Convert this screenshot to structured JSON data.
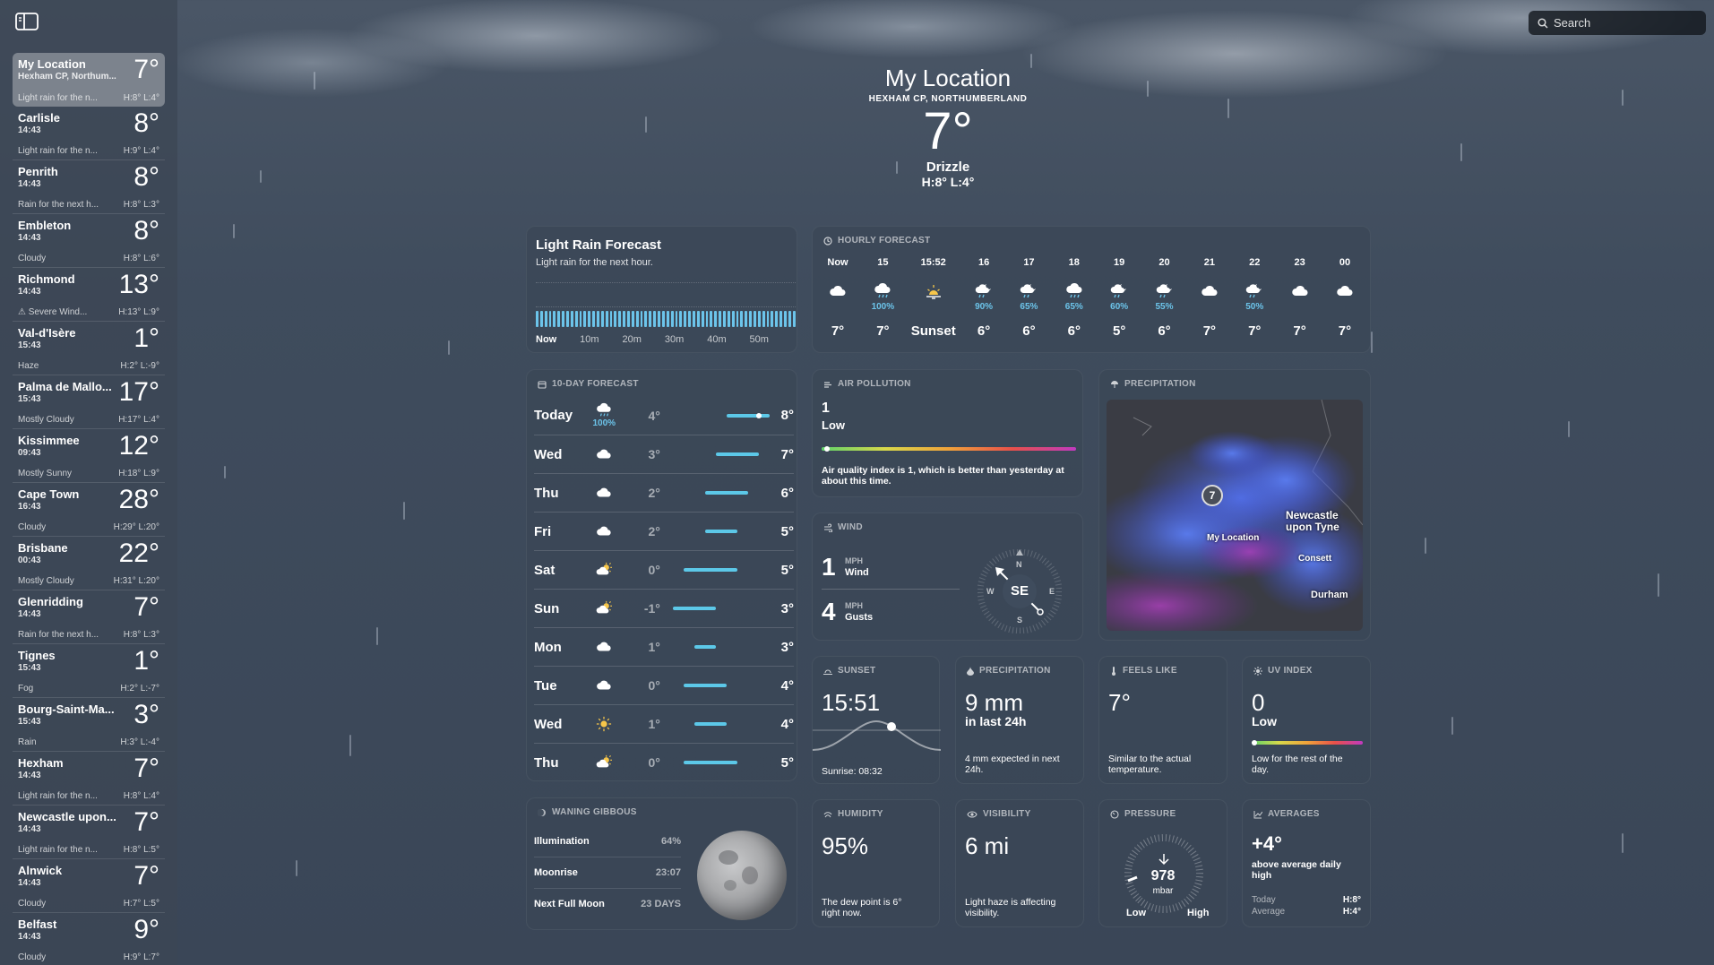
{
  "sidebar": {
    "locations": [
      {
        "name": "My Location",
        "time": "Hexham CP, Northum...",
        "temp": "7°",
        "cond": "Light rain for the n...",
        "hl": "H:8° L:4°",
        "selected": true
      },
      {
        "name": "Carlisle",
        "time": "14:43",
        "temp": "8°",
        "cond": "Light rain for the n...",
        "hl": "H:9° L:4°"
      },
      {
        "name": "Penrith",
        "time": "14:43",
        "temp": "8°",
        "cond": "Rain for the next h...",
        "hl": "H:8° L:3°"
      },
      {
        "name": "Embleton",
        "time": "14:43",
        "temp": "8°",
        "cond": "Cloudy",
        "hl": "H:8° L:6°"
      },
      {
        "name": "Richmond",
        "time": "14:43",
        "temp": "13°",
        "cond": "⚠ Severe Wind...",
        "hl": "H:13° L:9°"
      },
      {
        "name": "Val-d'Isère",
        "time": "15:43",
        "temp": "1°",
        "cond": "Haze",
        "hl": "H:2° L:-9°"
      },
      {
        "name": "Palma de Mallo...",
        "time": "15:43",
        "temp": "17°",
        "cond": "Mostly Cloudy",
        "hl": "H:17° L:4°"
      },
      {
        "name": "Kissimmee",
        "time": "09:43",
        "temp": "12°",
        "cond": "Mostly Sunny",
        "hl": "H:18° L:9°"
      },
      {
        "name": "Cape Town",
        "time": "16:43",
        "temp": "28°",
        "cond": "Cloudy",
        "hl": "H:29° L:20°"
      },
      {
        "name": "Brisbane",
        "time": "00:43",
        "temp": "22°",
        "cond": "Mostly Cloudy",
        "hl": "H:31° L:20°"
      },
      {
        "name": "Glenridding",
        "time": "14:43",
        "temp": "7°",
        "cond": "Rain for the next h...",
        "hl": "H:8° L:3°"
      },
      {
        "name": "Tignes",
        "time": "15:43",
        "temp": "1°",
        "cond": "Fog",
        "hl": "H:2° L:-7°"
      },
      {
        "name": "Bourg-Saint-Ma...",
        "time": "15:43",
        "temp": "3°",
        "cond": "Rain",
        "hl": "H:3° L:-4°"
      },
      {
        "name": "Hexham",
        "time": "14:43",
        "temp": "7°",
        "cond": "Light rain for the n...",
        "hl": "H:8° L:4°"
      },
      {
        "name": "Newcastle upon...",
        "time": "14:43",
        "temp": "7°",
        "cond": "Light rain for the n...",
        "hl": "H:8° L:5°"
      },
      {
        "name": "Alnwick",
        "time": "14:43",
        "temp": "7°",
        "cond": "Cloudy",
        "hl": "H:7° L:5°"
      },
      {
        "name": "Belfast",
        "time": "14:43",
        "temp": "9°",
        "cond": "Cloudy",
        "hl": "H:9° L:7°"
      }
    ]
  },
  "search": {
    "placeholder": "Search"
  },
  "header": {
    "title": "My Location",
    "subtitle": "HEXHAM CP, NORTHUMBERLAND",
    "temp": "7°",
    "condition": "Drizzle",
    "hl": "H:8°  L:4°"
  },
  "rain_forecast": {
    "title": "Light Rain Forecast",
    "subtitle": "Light rain for the next hour.",
    "ticks": [
      "Now",
      "10m",
      "20m",
      "30m",
      "40m",
      "50m"
    ]
  },
  "hourly": {
    "heading": "HOURLY FORECAST",
    "hours": [
      {
        "time": "Now",
        "icon": "cloud-icon",
        "pct": "",
        "temp": "7°"
      },
      {
        "time": "15",
        "icon": "cloud-rain-icon",
        "pct": "100%",
        "temp": "7°"
      },
      {
        "time": "15:52",
        "icon": "sunset-icon",
        "pct": "",
        "temp": "Sunset"
      },
      {
        "time": "16",
        "icon": "cloud-moon-rain-icon",
        "pct": "90%",
        "temp": "6°"
      },
      {
        "time": "17",
        "icon": "cloud-moon-rain-icon",
        "pct": "65%",
        "temp": "6°"
      },
      {
        "time": "18",
        "icon": "cloud-rain-icon",
        "pct": "65%",
        "temp": "6°"
      },
      {
        "time": "19",
        "icon": "cloud-moon-rain-icon",
        "pct": "60%",
        "temp": "5°"
      },
      {
        "time": "20",
        "icon": "cloud-moon-rain-icon",
        "pct": "55%",
        "temp": "6°"
      },
      {
        "time": "21",
        "icon": "cloud-icon",
        "pct": "",
        "temp": "7°"
      },
      {
        "time": "22",
        "icon": "cloud-moon-rain-icon",
        "pct": "50%",
        "temp": "7°"
      },
      {
        "time": "23",
        "icon": "cloud-icon",
        "pct": "",
        "temp": "7°"
      },
      {
        "time": "00",
        "icon": "cloud-icon",
        "pct": "",
        "temp": "7°"
      }
    ]
  },
  "ten_day": {
    "heading": "10-DAY FORECAST",
    "range_min": -1,
    "range_max": 8,
    "current_temp": 7,
    "days": [
      {
        "day": "Today",
        "icon": "cloud-rain-icon",
        "pct": "100%",
        "lo": "4°",
        "hi": "8°",
        "lo_v": 4,
        "hi_v": 8
      },
      {
        "day": "Wed",
        "icon": "cloud-icon",
        "pct": "",
        "lo": "3°",
        "hi": "7°",
        "lo_v": 3,
        "hi_v": 7
      },
      {
        "day": "Thu",
        "icon": "cloud-icon",
        "pct": "",
        "lo": "2°",
        "hi": "6°",
        "lo_v": 2,
        "hi_v": 6
      },
      {
        "day": "Fri",
        "icon": "cloud-icon",
        "pct": "",
        "lo": "2°",
        "hi": "5°",
        "lo_v": 2,
        "hi_v": 5
      },
      {
        "day": "Sat",
        "icon": "partly-cloudy-icon",
        "pct": "",
        "lo": "0°",
        "hi": "5°",
        "lo_v": 0,
        "hi_v": 5
      },
      {
        "day": "Sun",
        "icon": "partly-cloudy-icon",
        "pct": "",
        "lo": "-1°",
        "hi": "3°",
        "lo_v": -1,
        "hi_v": 3
      },
      {
        "day": "Mon",
        "icon": "cloud-icon",
        "pct": "",
        "lo": "1°",
        "hi": "3°",
        "lo_v": 1,
        "hi_v": 3
      },
      {
        "day": "Tue",
        "icon": "cloud-icon",
        "pct": "",
        "lo": "0°",
        "hi": "4°",
        "lo_v": 0,
        "hi_v": 4
      },
      {
        "day": "Wed",
        "icon": "sun-icon",
        "pct": "",
        "lo": "1°",
        "hi": "4°",
        "lo_v": 1,
        "hi_v": 4
      },
      {
        "day": "Thu",
        "icon": "partly-cloudy-icon",
        "pct": "",
        "lo": "0°",
        "hi": "5°",
        "lo_v": 0,
        "hi_v": 5
      }
    ]
  },
  "air": {
    "heading": "AIR POLLUTION",
    "value": "1",
    "level": "Low",
    "level_fraction": 0.02,
    "desc": "Air quality index is 1, which is better than yesterday at about this time."
  },
  "wind": {
    "heading": "WIND",
    "wind_val": "1",
    "wind_unit": "MPH",
    "wind_label": "Wind",
    "gust_val": "4",
    "gust_unit": "MPH",
    "gust_label": "Gusts",
    "direction": "SE",
    "n": "N",
    "s": "S",
    "e": "E",
    "w": "W"
  },
  "precip_map": {
    "heading": "PRECIPITATION",
    "marker": "7",
    "my_location": "My Location",
    "city1": "Newcastle upon Tyne",
    "city2": "Consett",
    "city3": "Durham"
  },
  "sunset": {
    "heading": "SUNSET",
    "time": "15:51",
    "sunrise": "Sunrise: 08:32"
  },
  "precipitation": {
    "heading": "PRECIPITATION",
    "value": "9 mm",
    "sub": "in last 24h",
    "desc": "4 mm expected in next 24h."
  },
  "feels_like": {
    "heading": "FEELS LIKE",
    "value": "7°",
    "desc": "Similar to the actual temperature."
  },
  "uv": {
    "heading": "UV INDEX",
    "value": "0",
    "level": "Low",
    "level_fraction": 0.0,
    "desc": "Low for the rest of the day."
  },
  "moon": {
    "heading": "WANING GIBBOUS",
    "rows": [
      {
        "label": "Illumination",
        "value": "64%"
      },
      {
        "label": "Moonrise",
        "value": "23:07"
      },
      {
        "label": "Next Full Moon",
        "value": "23 DAYS"
      }
    ]
  },
  "humidity": {
    "heading": "HUMIDITY",
    "value": "95%",
    "desc": "The dew point is 6° right now."
  },
  "visibility": {
    "heading": "VISIBILITY",
    "value": "6 mi",
    "desc": "Light haze is affecting visibility."
  },
  "pressure": {
    "heading": "PRESSURE",
    "value": "978",
    "unit": "mbar",
    "low": "Low",
    "high": "High"
  },
  "averages": {
    "heading": "AVERAGES",
    "value": "+4°",
    "desc": "above average daily high",
    "today_label": "Today",
    "today_val": "H:8°",
    "avg_label": "Average",
    "avg_val": "H:4°"
  },
  "colors": {
    "accent_blue": "#6cc4ea",
    "bar": "#5cc8e8"
  }
}
